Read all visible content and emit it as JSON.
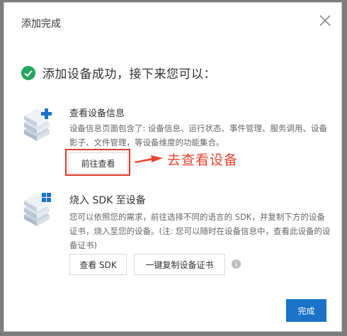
{
  "dialog": {
    "title": "添加完成",
    "success_text": "添加设备成功，接下来您可以："
  },
  "section_view": {
    "title": "查看设备信息",
    "description": "设备信息页面包含了: 设备信息、运行状态、事件管理、服务调用、设备影子、文件管理，等设备维度的功能集合。",
    "button_label": "前往查看",
    "annotation": "去查看设备"
  },
  "section_sdk": {
    "title": "烧入 SDK 至设备",
    "description": "您可以依照您的需求，前往选择不同的语言的 SDK，并复制下方的设备证书，烧入至您的设备。(注: 您可以随时在设备信息中，查看此设备的设备证书)",
    "btn_sdk": "查看 SDK",
    "btn_copy": "一键复制设备证书"
  },
  "footer": {
    "done_label": "完成"
  },
  "colors": {
    "success_green": "#22a55a",
    "primary_blue": "#1a73c8",
    "annotation_red": "#e8432f"
  },
  "icons": [
    "close-icon",
    "success-check-icon",
    "device-stack-add-icon",
    "device-stack-grid-icon",
    "info-icon",
    "red-arrow-icon"
  ]
}
